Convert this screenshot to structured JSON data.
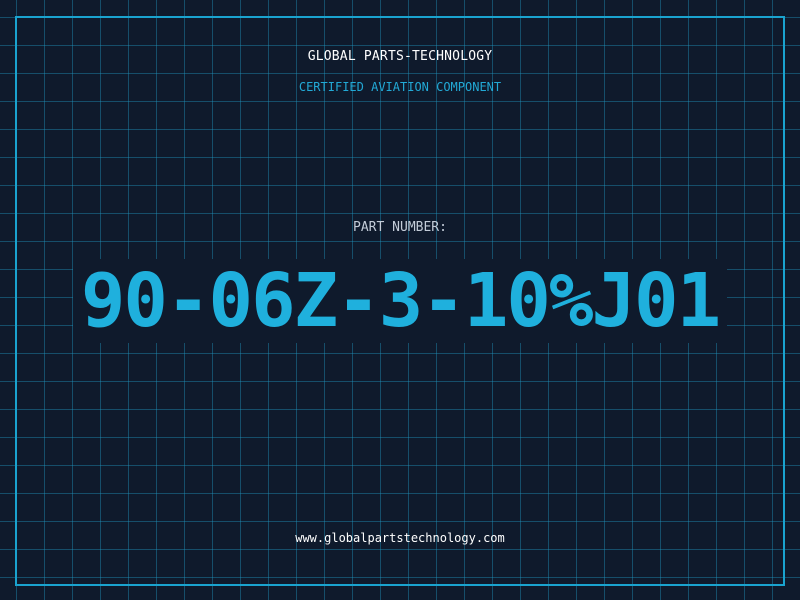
{
  "header": {
    "company": "GLOBAL PARTS-TECHNOLOGY",
    "tagline": "CERTIFIED AVIATION COMPONENT"
  },
  "part": {
    "label": "PART NUMBER:",
    "number": "90-06Z-3-10%J01"
  },
  "footer": {
    "website": "www.globalpartstechnology.com"
  },
  "colors": {
    "background": "#0f1a2c",
    "grid": "#1f7fa3",
    "frame": "#1aa3cf",
    "accent": "#1fb0dd",
    "text": "#ffffff"
  }
}
